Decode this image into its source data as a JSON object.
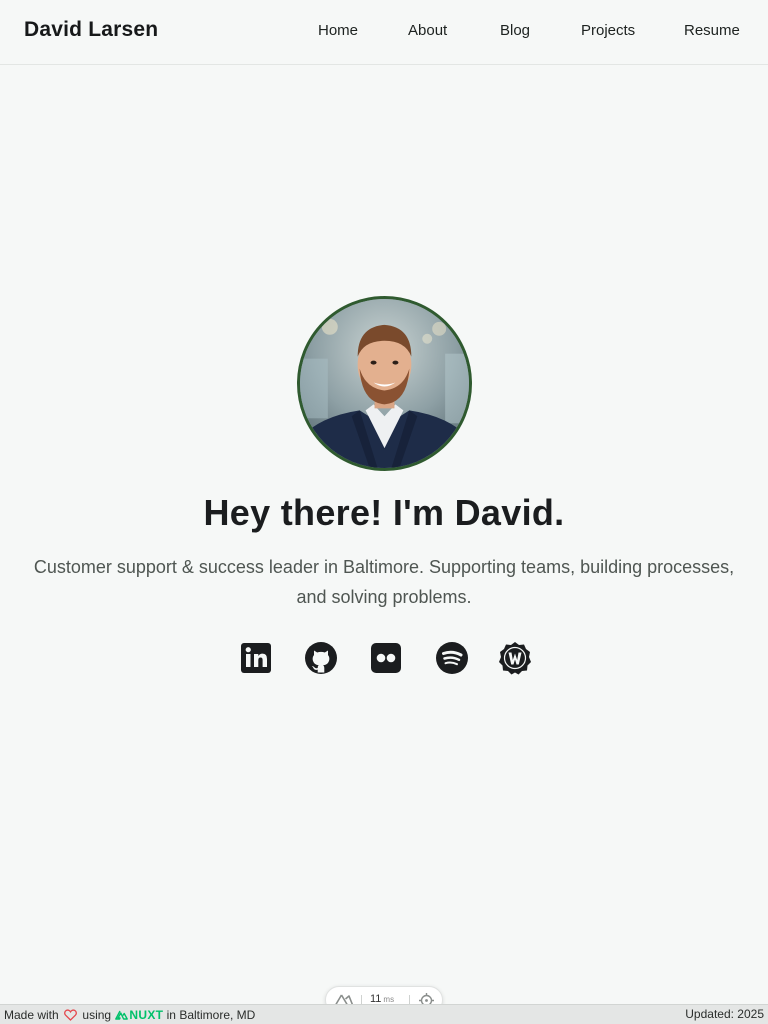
{
  "header": {
    "brand": "David Larsen",
    "nav": [
      {
        "label": "Home"
      },
      {
        "label": "About"
      },
      {
        "label": "Blog"
      },
      {
        "label": "Projects"
      },
      {
        "label": "Resume"
      }
    ]
  },
  "hero": {
    "avatar_alt": "David Larsen",
    "headline": "Hey there! I'm David.",
    "tagline": "Customer support & success leader in Baltimore. Supporting teams, building processes, and solving problems."
  },
  "socials": [
    {
      "icon": "linkedin-icon"
    },
    {
      "icon": "github-icon"
    },
    {
      "icon": "flickr-icon"
    },
    {
      "icon": "spotify-icon"
    },
    {
      "icon": "w-badge-icon"
    }
  ],
  "footer": {
    "made_with": "Made with",
    "using": "using",
    "framework": "NUXT",
    "location": "in Baltimore, MD",
    "updated": "Updated: 2025"
  },
  "devtools": {
    "time_value": "11",
    "time_unit": "ms"
  },
  "colors": {
    "background": "#f6f8f7",
    "avatar_border": "#2f5a2f",
    "heart": "#e5484d",
    "nuxt_green": "#00c16a"
  }
}
